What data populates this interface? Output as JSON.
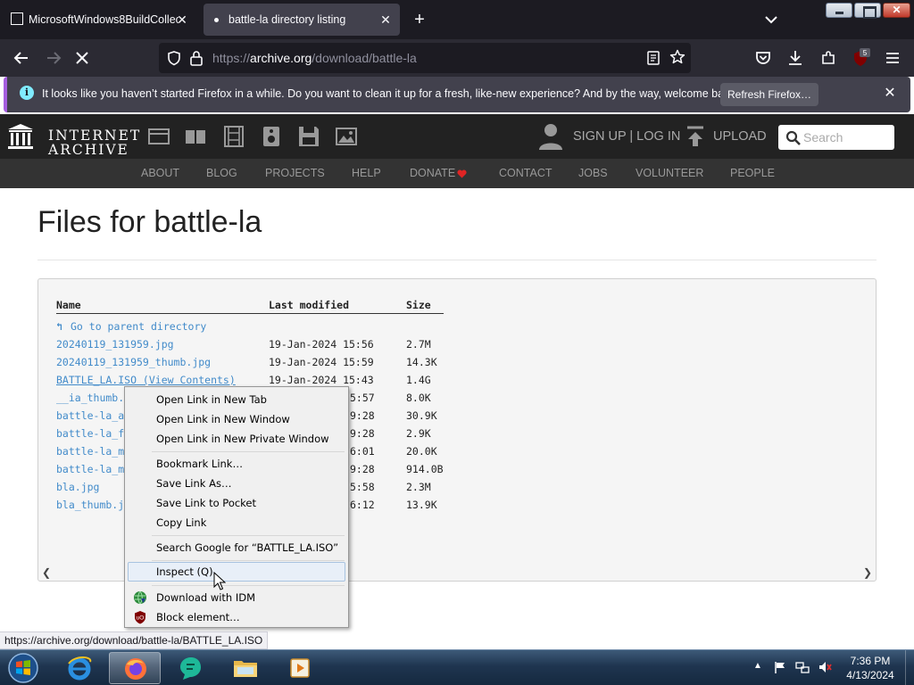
{
  "browser": {
    "tabs": [
      {
        "title": "MicrosoftWindows8BuildCollec",
        "active": false
      },
      {
        "title": "battle-la directory listing",
        "active": true
      }
    ],
    "url": {
      "prefix": "https://",
      "host": "archive.org",
      "path": "/download/battle-la"
    },
    "notification": {
      "text": "It looks like you haven’t started Firefox in a while. Do you want to clean it up for a fresh, like-new experience? And by the way, welcome back!",
      "button": "Refresh Firefox…"
    },
    "extension_badge": "5",
    "status_url": "https://archive.org/download/battle-la/BATTLE_LA.ISO"
  },
  "ia": {
    "logo_line1": "INTERNET",
    "logo_line2": "ARCHIVE",
    "signup": "SIGN UP | LOG IN",
    "upload": "UPLOAD",
    "search_placeholder": "Search",
    "subnav": [
      "ABOUT",
      "BLOG",
      "PROJECTS",
      "HELP",
      "DONATE",
      "CONTACT",
      "JOBS",
      "VOLUNTEER",
      "PEOPLE"
    ],
    "accent_heart": "#e02424"
  },
  "page": {
    "title": "Files for battle-la",
    "columns": {
      "name": "Name",
      "modified": "Last modified",
      "size": "Size"
    },
    "parent": "Go to parent directory",
    "files": [
      {
        "name": "20240119_131959.jpg",
        "date": "19-Jan-2024 15:56",
        "size": "2.7M"
      },
      {
        "name": "20240119_131959_thumb.jpg",
        "date": "19-Jan-2024 15:59",
        "size": "14.3K"
      },
      {
        "name": "BATTLE_LA.ISO (View Contents)",
        "date": "19-Jan-2024 15:43",
        "size": "1.4G"
      },
      {
        "name": "__ia_thumb.",
        "date": "5:57",
        "size": "8.0K"
      },
      {
        "name": "battle-la_a",
        "date": "9:28",
        "size": "30.9K"
      },
      {
        "name": "battle-la_f",
        "date": "9:28",
        "size": "2.9K"
      },
      {
        "name": "battle-la_m",
        "date": "6:01",
        "size": "20.0K"
      },
      {
        "name": "battle-la_m",
        "date": "9:28",
        "size": "914.0B"
      },
      {
        "name": "bla.jpg",
        "date": "5:58",
        "size": "2.3M"
      },
      {
        "name": "bla_thumb.j",
        "date": "6:12",
        "size": "13.9K"
      }
    ]
  },
  "context_menu": {
    "open_new_tab": "Open Link in New Tab",
    "open_new_window": "Open Link in New Window",
    "open_private": "Open Link in New Private Window",
    "bookmark": "Bookmark Link…",
    "save_as": "Save Link As…",
    "save_pocket": "Save Link to Pocket",
    "copy_link": "Copy Link",
    "search_google": "Search Google for “BATTLE_LA.ISO”",
    "inspect": "Inspect (Q)",
    "download_idm": "Download with IDM",
    "block_element": "Block element…"
  },
  "taskbar": {
    "time": "7:36 PM",
    "date": "4/13/2024"
  }
}
